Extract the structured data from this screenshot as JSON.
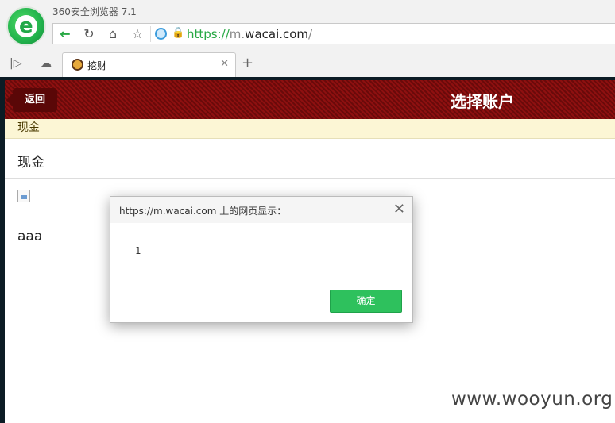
{
  "browser": {
    "app_title": "360安全浏览器 7.1",
    "logo_letter": "e",
    "url": {
      "scheme": "https://",
      "subdomain": "m.",
      "domain": "wacai.com",
      "path": "/"
    },
    "tab": {
      "label": "挖财"
    }
  },
  "page": {
    "header": {
      "back_label": "返回",
      "title": "选择账户"
    },
    "section_header": "现金",
    "rows": [
      {
        "label": "现金"
      },
      {
        "label": ""
      },
      {
        "label": "aaa"
      }
    ]
  },
  "dialog": {
    "title": "https://m.wacai.com 上的网页显示：",
    "message": "1",
    "ok_label": "确定"
  },
  "watermark": "www.wooyun.org",
  "colors": {
    "brand_green": "#27a844",
    "header_red": "#8e1010",
    "ok_green": "#2ec15d",
    "section_bg": "#fcf6d5"
  }
}
